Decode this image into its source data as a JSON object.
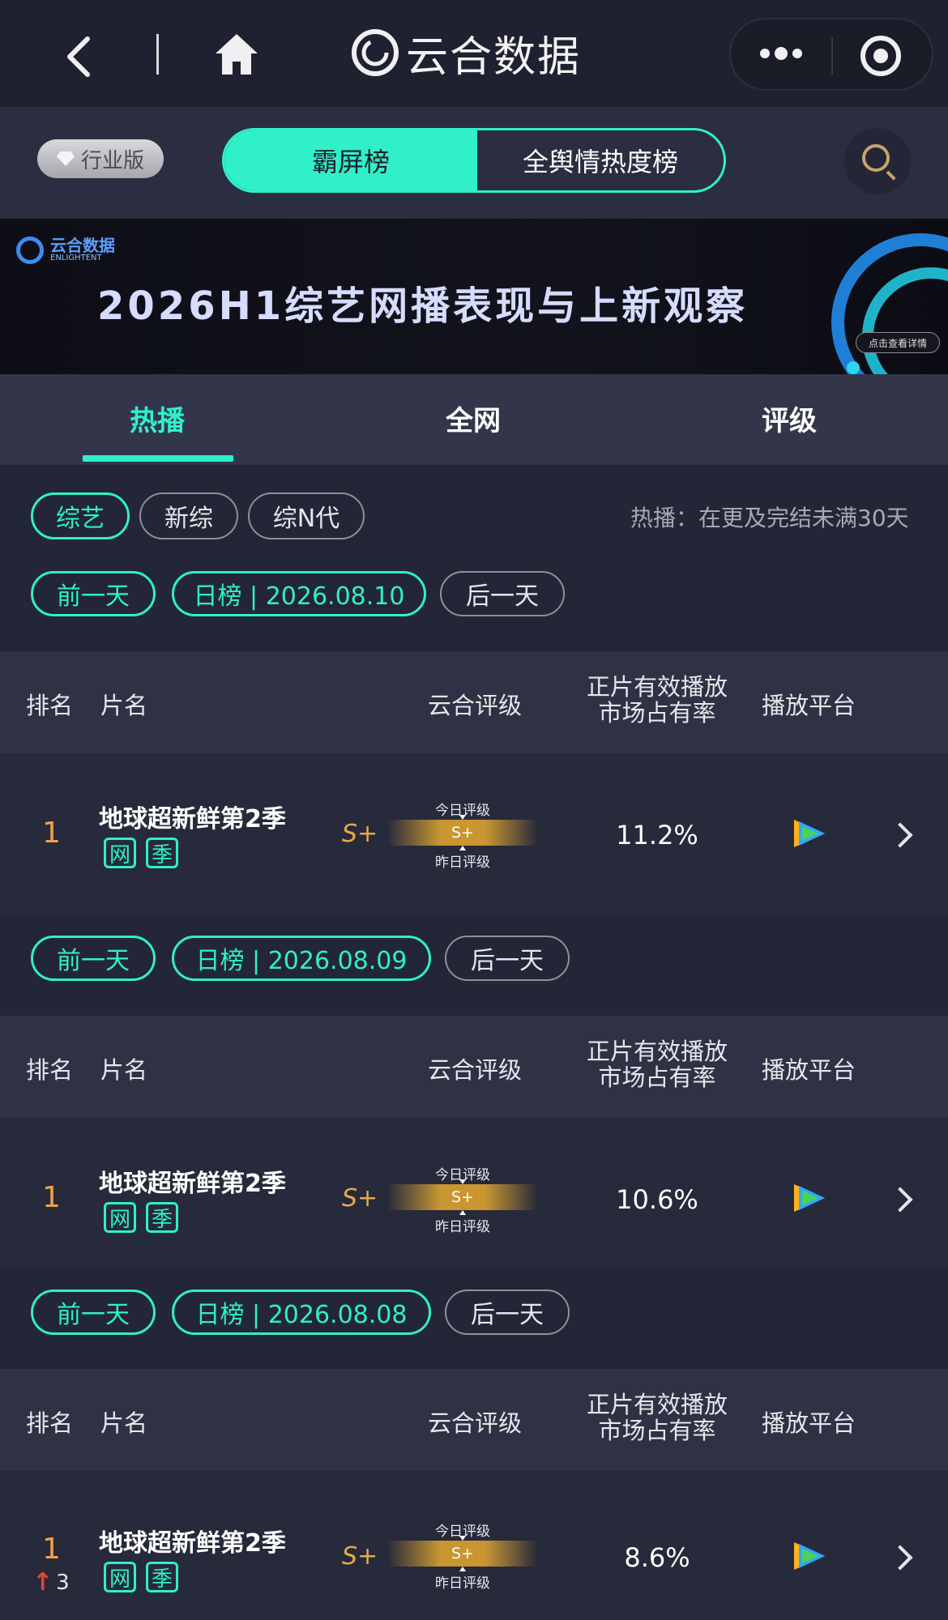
{
  "nav": {
    "brand": "云合数据"
  },
  "header": {
    "industry_badge": "行业版",
    "segments": [
      "霸屏榜",
      "全舆情热度榜"
    ]
  },
  "banner": {
    "logo_cn": "云合数据",
    "logo_en": "ENLIGHTENT",
    "title": "2026H1综艺网播表现与上新观察",
    "cta": "点击查看详情"
  },
  "tabs": [
    {
      "label": "热播",
      "active": true
    },
    {
      "label": "全网",
      "active": false
    },
    {
      "label": "评级",
      "active": false
    }
  ],
  "filters": {
    "categories": [
      {
        "label": "综艺",
        "selected": true
      },
      {
        "label": "新综",
        "selected": false
      },
      {
        "label": "综N代",
        "selected": false
      }
    ],
    "note": "热播：在更及完结未满30天"
  },
  "table_headers": {
    "rank": "排名",
    "name": "片名",
    "grade": "云合评级",
    "share_line1": "正片有效播放",
    "share_line2": "市场占有率",
    "platform": "播放平台"
  },
  "days": [
    {
      "prev": "前一天",
      "date": "日榜 | 2026.08.10",
      "next": "后一天",
      "rows": [
        {
          "rank": "1",
          "rank_change": "",
          "title": "地球超新鲜第2季",
          "tags": [
            "网",
            "季"
          ],
          "grade": "S+",
          "grade_today_label": "今日评级",
          "grade_bar": "S+",
          "grade_yesterday_label": "昨日评级",
          "share": "11.2%",
          "platform_icon": "tencent-video-icon"
        }
      ]
    },
    {
      "prev": "前一天",
      "date": "日榜 | 2026.08.09",
      "next": "后一天",
      "rows": [
        {
          "rank": "1",
          "rank_change": "",
          "title": "地球超新鲜第2季",
          "tags": [
            "网",
            "季"
          ],
          "grade": "S+",
          "grade_today_label": "今日评级",
          "grade_bar": "S+",
          "grade_yesterday_label": "昨日评级",
          "share": "10.6%",
          "platform_icon": "tencent-video-icon"
        }
      ]
    },
    {
      "prev": "前一天",
      "date": "日榜 | 2026.08.08",
      "next": "后一天",
      "rows": [
        {
          "rank": "1",
          "rank_change": "3",
          "title": "地球超新鲜第2季",
          "tags": [
            "网",
            "季"
          ],
          "grade": "S+",
          "grade_today_label": "今日评级",
          "grade_bar": "S+",
          "grade_yesterday_label": "昨日评级",
          "share": "8.6%",
          "platform_icon": "tencent-video-icon"
        }
      ]
    }
  ],
  "colors": {
    "accent": "#2ff0c9",
    "rank": "#f1a04a",
    "grade": "#e7a94a",
    "background": "#232636"
  }
}
